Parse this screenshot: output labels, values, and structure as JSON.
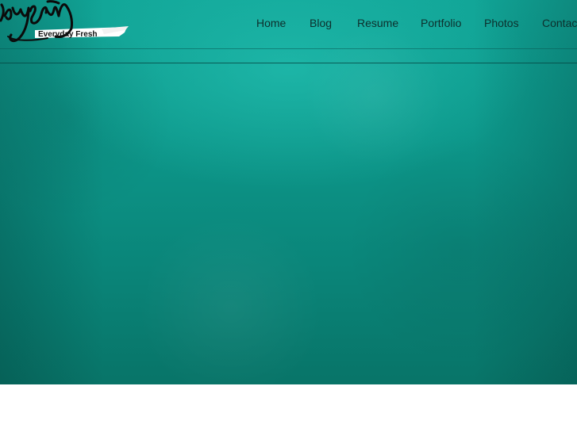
{
  "logo": {
    "script_text": "EveryFresh",
    "tagline": "Everyday Fresh"
  },
  "nav": {
    "items": [
      {
        "label": "Home"
      },
      {
        "label": "Blog"
      },
      {
        "label": "Resume"
      },
      {
        "label": "Portfolio"
      },
      {
        "label": "Photos"
      },
      {
        "label": "Contact"
      }
    ]
  },
  "colors": {
    "hero_teal": "#0d978a",
    "nav_text": "#0d2f2c",
    "page_background": "#ffffff"
  }
}
